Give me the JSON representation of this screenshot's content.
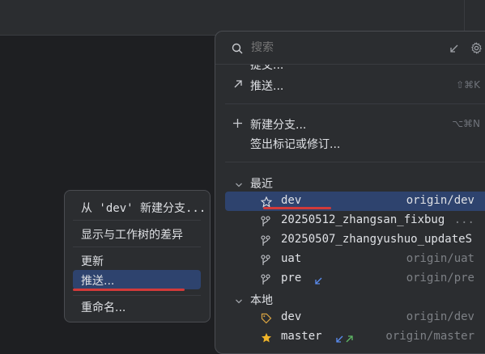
{
  "search": {
    "placeholder": "搜索"
  },
  "actions": {
    "clipped_label": "提交...",
    "push": {
      "label": "推送...",
      "shortcut": "⇧⌘K"
    },
    "new_branch": {
      "label": "新建分支...",
      "shortcut": "⌥⌘N"
    },
    "checkout_tag": {
      "label": "签出标记或修订..."
    }
  },
  "recent": {
    "header": "最近",
    "branches": [
      {
        "name": "dev",
        "remote": "origin/dev",
        "icon": "star-outline-icon"
      },
      {
        "name": "20250512_zhangsan_fixbug",
        "remote": "...",
        "icon": "branch-icon"
      },
      {
        "name": "20250507_zhangyushuo_updateS",
        "remote": "",
        "icon": "branch-icon"
      },
      {
        "name": "uat",
        "remote": "origin/uat",
        "icon": "branch-icon"
      },
      {
        "name": "pre",
        "remote": "origin/pre",
        "icon": "branch-icon"
      }
    ]
  },
  "local": {
    "header": "本地",
    "branches": [
      {
        "name": "dev",
        "remote": "origin/dev",
        "icon": "tag-icon"
      },
      {
        "name": "master",
        "remote": "origin/master",
        "icon": "star-filled-icon"
      }
    ]
  },
  "context_menu": {
    "new_branch_from": "从 'dev' 新建分支...",
    "show_diff": "显示与工作树的差异",
    "update": "更新",
    "push": "推送...",
    "rename": "重命名..."
  },
  "colors": {
    "selection": "#2e436e",
    "annotation_red": "#d23a3a",
    "incoming_arrow_blue": "#5a8cf0",
    "outgoing_arrow_green": "#5fb865",
    "star_gold": "#f0b429"
  }
}
